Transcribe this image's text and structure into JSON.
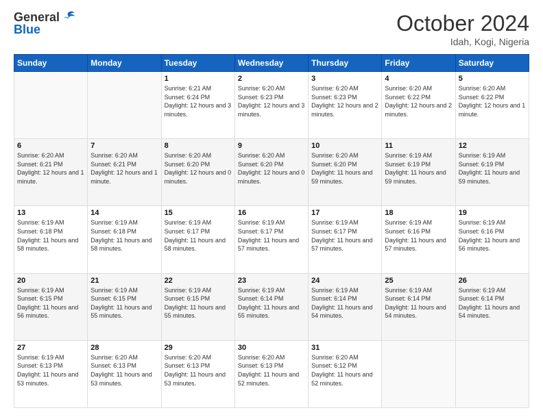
{
  "header": {
    "logo_general": "General",
    "logo_blue": "Blue",
    "month_title": "October 2024",
    "location": "Idah, Kogi, Nigeria"
  },
  "days_of_week": [
    "Sunday",
    "Monday",
    "Tuesday",
    "Wednesday",
    "Thursday",
    "Friday",
    "Saturday"
  ],
  "weeks": [
    [
      {
        "day": "",
        "info": ""
      },
      {
        "day": "",
        "info": ""
      },
      {
        "day": "1",
        "info": "Sunrise: 6:21 AM\nSunset: 6:24 PM\nDaylight: 12 hours and 3 minutes."
      },
      {
        "day": "2",
        "info": "Sunrise: 6:20 AM\nSunset: 6:23 PM\nDaylight: 12 hours and 3 minutes."
      },
      {
        "day": "3",
        "info": "Sunrise: 6:20 AM\nSunset: 6:23 PM\nDaylight: 12 hours and 2 minutes."
      },
      {
        "day": "4",
        "info": "Sunrise: 6:20 AM\nSunset: 6:22 PM\nDaylight: 12 hours and 2 minutes."
      },
      {
        "day": "5",
        "info": "Sunrise: 6:20 AM\nSunset: 6:22 PM\nDaylight: 12 hours and 1 minute."
      }
    ],
    [
      {
        "day": "6",
        "info": "Sunrise: 6:20 AM\nSunset: 6:21 PM\nDaylight: 12 hours and 1 minute."
      },
      {
        "day": "7",
        "info": "Sunrise: 6:20 AM\nSunset: 6:21 PM\nDaylight: 12 hours and 1 minute."
      },
      {
        "day": "8",
        "info": "Sunrise: 6:20 AM\nSunset: 6:20 PM\nDaylight: 12 hours and 0 minutes."
      },
      {
        "day": "9",
        "info": "Sunrise: 6:20 AM\nSunset: 6:20 PM\nDaylight: 12 hours and 0 minutes."
      },
      {
        "day": "10",
        "info": "Sunrise: 6:20 AM\nSunset: 6:20 PM\nDaylight: 11 hours and 59 minutes."
      },
      {
        "day": "11",
        "info": "Sunrise: 6:19 AM\nSunset: 6:19 PM\nDaylight: 11 hours and 59 minutes."
      },
      {
        "day": "12",
        "info": "Sunrise: 6:19 AM\nSunset: 6:19 PM\nDaylight: 11 hours and 59 minutes."
      }
    ],
    [
      {
        "day": "13",
        "info": "Sunrise: 6:19 AM\nSunset: 6:18 PM\nDaylight: 11 hours and 58 minutes."
      },
      {
        "day": "14",
        "info": "Sunrise: 6:19 AM\nSunset: 6:18 PM\nDaylight: 11 hours and 58 minutes."
      },
      {
        "day": "15",
        "info": "Sunrise: 6:19 AM\nSunset: 6:17 PM\nDaylight: 11 hours and 58 minutes."
      },
      {
        "day": "16",
        "info": "Sunrise: 6:19 AM\nSunset: 6:17 PM\nDaylight: 11 hours and 57 minutes."
      },
      {
        "day": "17",
        "info": "Sunrise: 6:19 AM\nSunset: 6:17 PM\nDaylight: 11 hours and 57 minutes."
      },
      {
        "day": "18",
        "info": "Sunrise: 6:19 AM\nSunset: 6:16 PM\nDaylight: 11 hours and 57 minutes."
      },
      {
        "day": "19",
        "info": "Sunrise: 6:19 AM\nSunset: 6:16 PM\nDaylight: 11 hours and 56 minutes."
      }
    ],
    [
      {
        "day": "20",
        "info": "Sunrise: 6:19 AM\nSunset: 6:15 PM\nDaylight: 11 hours and 56 minutes."
      },
      {
        "day": "21",
        "info": "Sunrise: 6:19 AM\nSunset: 6:15 PM\nDaylight: 11 hours and 55 minutes."
      },
      {
        "day": "22",
        "info": "Sunrise: 6:19 AM\nSunset: 6:15 PM\nDaylight: 11 hours and 55 minutes."
      },
      {
        "day": "23",
        "info": "Sunrise: 6:19 AM\nSunset: 6:14 PM\nDaylight: 11 hours and 55 minutes."
      },
      {
        "day": "24",
        "info": "Sunrise: 6:19 AM\nSunset: 6:14 PM\nDaylight: 11 hours and 54 minutes."
      },
      {
        "day": "25",
        "info": "Sunrise: 6:19 AM\nSunset: 6:14 PM\nDaylight: 11 hours and 54 minutes."
      },
      {
        "day": "26",
        "info": "Sunrise: 6:19 AM\nSunset: 6:14 PM\nDaylight: 11 hours and 54 minutes."
      }
    ],
    [
      {
        "day": "27",
        "info": "Sunrise: 6:19 AM\nSunset: 6:13 PM\nDaylight: 11 hours and 53 minutes."
      },
      {
        "day": "28",
        "info": "Sunrise: 6:20 AM\nSunset: 6:13 PM\nDaylight: 11 hours and 53 minutes."
      },
      {
        "day": "29",
        "info": "Sunrise: 6:20 AM\nSunset: 6:13 PM\nDaylight: 11 hours and 53 minutes."
      },
      {
        "day": "30",
        "info": "Sunrise: 6:20 AM\nSunset: 6:13 PM\nDaylight: 11 hours and 52 minutes."
      },
      {
        "day": "31",
        "info": "Sunrise: 6:20 AM\nSunset: 6:12 PM\nDaylight: 11 hours and 52 minutes."
      },
      {
        "day": "",
        "info": ""
      },
      {
        "day": "",
        "info": ""
      }
    ]
  ]
}
